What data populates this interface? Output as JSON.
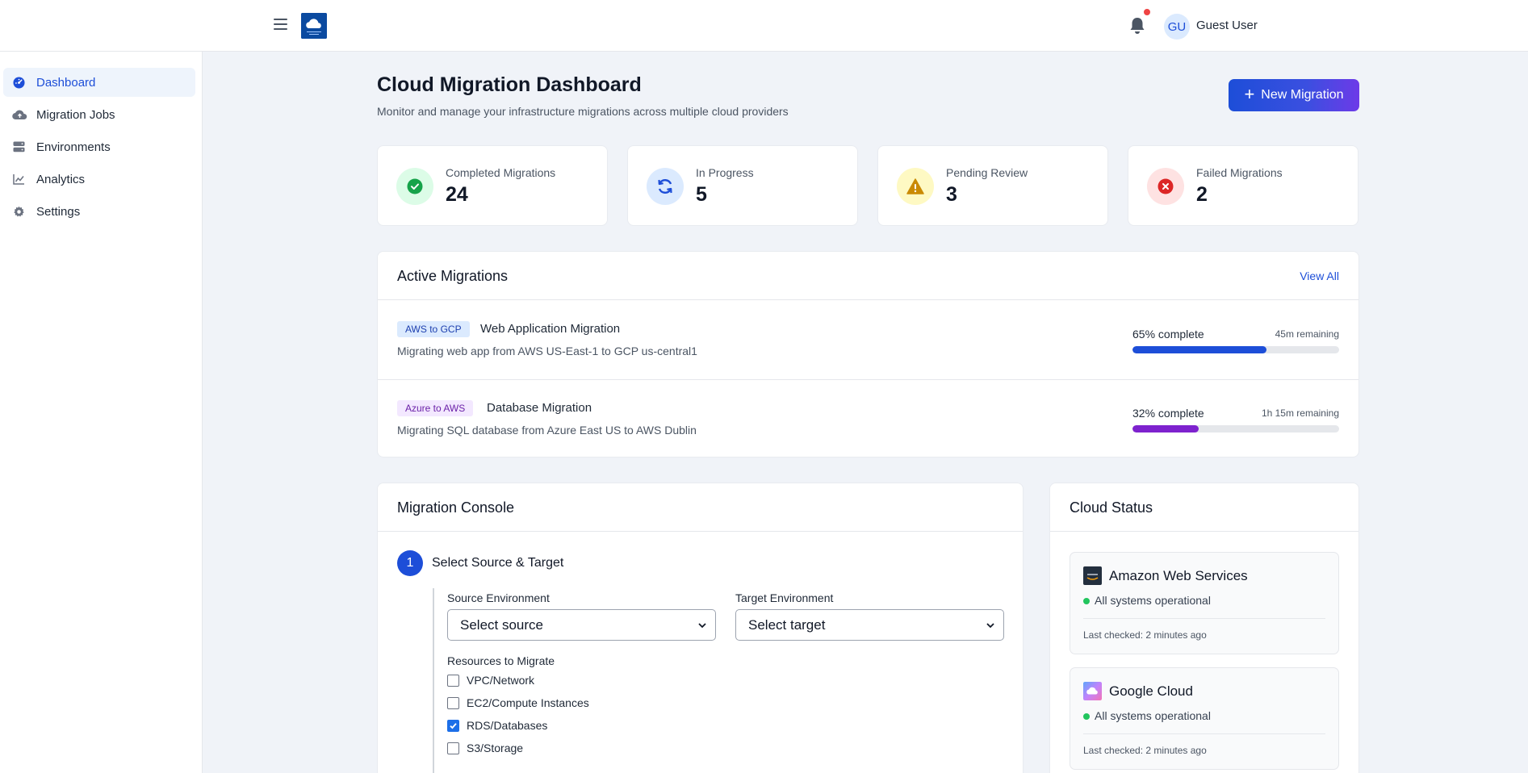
{
  "header": {
    "user_initials": "GU",
    "user_name": "Guest User"
  },
  "sidebar": {
    "items": [
      {
        "label": "Dashboard",
        "icon": "dashboard-gauge-icon",
        "active": true
      },
      {
        "label": "Migration Jobs",
        "icon": "cloud-upload-icon",
        "active": false
      },
      {
        "label": "Environments",
        "icon": "server-icon",
        "active": false
      },
      {
        "label": "Analytics",
        "icon": "line-chart-icon",
        "active": false
      },
      {
        "label": "Settings",
        "icon": "gear-icon",
        "active": false
      }
    ]
  },
  "page": {
    "title": "Cloud Migration Dashboard",
    "subtitle": "Monitor and manage your infrastructure migrations across multiple cloud providers",
    "new_button": "New Migration"
  },
  "stats": [
    {
      "label": "Completed Migrations",
      "value": "24",
      "icon": "check-circle-icon",
      "color": "#16a34a",
      "bg": "#dcfce7"
    },
    {
      "label": "In Progress",
      "value": "5",
      "icon": "sync-icon",
      "color": "#1d4ed8",
      "bg": "#dbeafe"
    },
    {
      "label": "Pending Review",
      "value": "3",
      "icon": "warning-icon",
      "color": "#ca8a04",
      "bg": "#fef9c3"
    },
    {
      "label": "Failed Migrations",
      "value": "2",
      "icon": "x-circle-icon",
      "color": "#dc2626",
      "bg": "#fee2e2"
    }
  ],
  "active": {
    "title": "Active Migrations",
    "view_all": "View All",
    "items": [
      {
        "tag": "AWS to GCP",
        "tag_color": "#1e40af",
        "tag_bg": "#dbeafe",
        "name": "Web Application Migration",
        "desc": "Migrating web app from AWS US-East-1 to GCP us-central1",
        "progress": 65,
        "pct_label": "65% complete",
        "remaining": "45m remaining",
        "bar_color": "#1d4ed8"
      },
      {
        "tag": "Azure to AWS",
        "tag_color": "#6b21a8",
        "tag_bg": "#f3e8ff",
        "name": "Database Migration",
        "desc": "Migrating SQL database from Azure East US to AWS Dublin",
        "progress": 32,
        "pct_label": "32% complete",
        "remaining": "1h 15m remaining",
        "bar_color": "#7e22ce"
      }
    ]
  },
  "console": {
    "title": "Migration Console",
    "step_number": "1",
    "step_title": "Select Source & Target",
    "source_label": "Source Environment",
    "source_value": "Select source",
    "target_label": "Target Environment",
    "target_value": "Select target",
    "resources_label": "Resources to Migrate",
    "resources": [
      {
        "label": "VPC/Network",
        "checked": false
      },
      {
        "label": "EC2/Compute Instances",
        "checked": false
      },
      {
        "label": "RDS/Databases",
        "checked": true
      },
      {
        "label": "S3/Storage",
        "checked": false
      }
    ]
  },
  "cloud_status": {
    "title": "Cloud Status",
    "providers": [
      {
        "name": "Amazon Web Services",
        "status": "All systems operational",
        "checked": "Last checked: 2 minutes ago",
        "logo": "aws-logo-icon"
      },
      {
        "name": "Google Cloud",
        "status": "All systems operational",
        "checked": "Last checked: 2 minutes ago",
        "logo": "google-cloud-logo-icon"
      }
    ]
  }
}
